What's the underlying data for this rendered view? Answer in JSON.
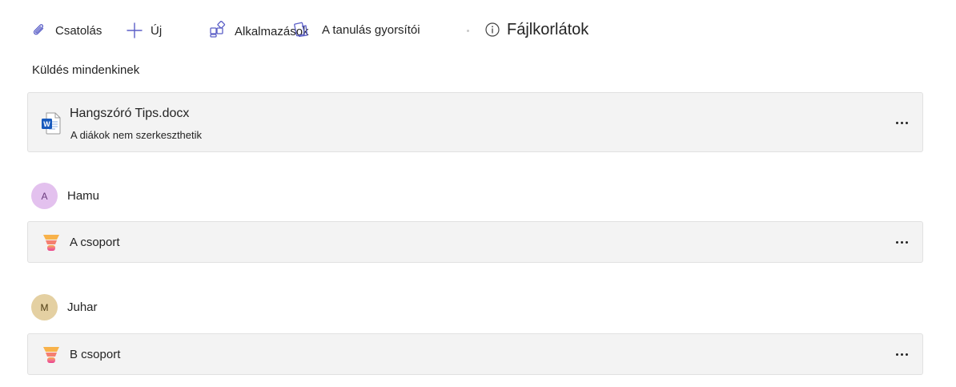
{
  "toolbar": {
    "attach_label": "Csatolás",
    "new_label": "Új",
    "apps_label": "Alkalmazások",
    "accelerators_label": "A tanulás gyorsítói",
    "file_limits_label": "Fájlkorlátok"
  },
  "section": {
    "send_to_all_label": "Küldés mindenkinek"
  },
  "file_card": {
    "name": "Hangszóró Tips.docx",
    "subtitle": "A diákok nem szerkeszthetik",
    "icon": "word-doc-icon"
  },
  "students": [
    {
      "initial": "A",
      "name": "Hamu",
      "avatar_color": "#e3c1ee",
      "group": {
        "name": "A csoport",
        "icon": "speaker-progress-icon"
      }
    },
    {
      "initial": "M",
      "name": "Juhar",
      "avatar_color": "#e4d0a2",
      "group": {
        "name": "B csoport",
        "icon": "speaker-progress-icon"
      }
    }
  ],
  "colors": {
    "card_background": "#f3f3f3",
    "accent": "#5b5fc7",
    "word_blue": "#185abd"
  }
}
